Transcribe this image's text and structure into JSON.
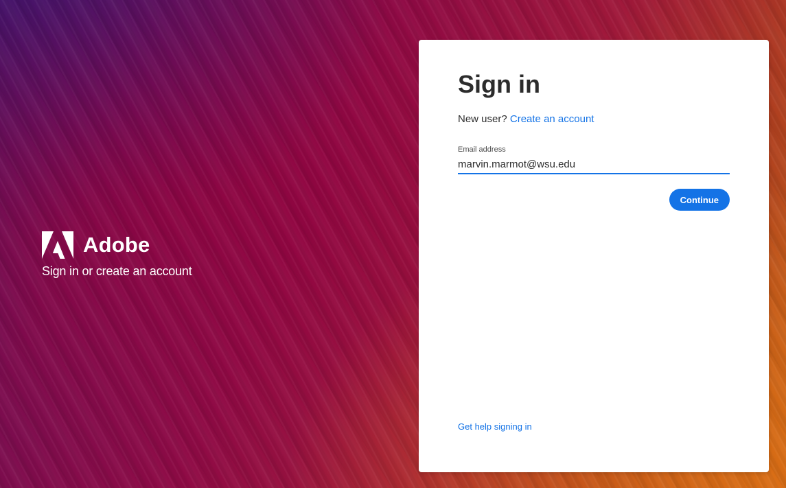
{
  "branding": {
    "logo_icon": "adobe-logo-icon",
    "name": "Adobe",
    "tagline": "Sign in or create an account"
  },
  "signin": {
    "title": "Sign in",
    "new_user_prompt": "New user?",
    "create_account_link": "Create an account",
    "email_label": "Email address",
    "email_value": "marvin.marmot@wsu.edu",
    "continue_label": "Continue",
    "help_link": "Get help signing in"
  },
  "colors": {
    "accent": "#1473e6",
    "text": "#2c2c2c",
    "card_background": "#ffffff"
  }
}
